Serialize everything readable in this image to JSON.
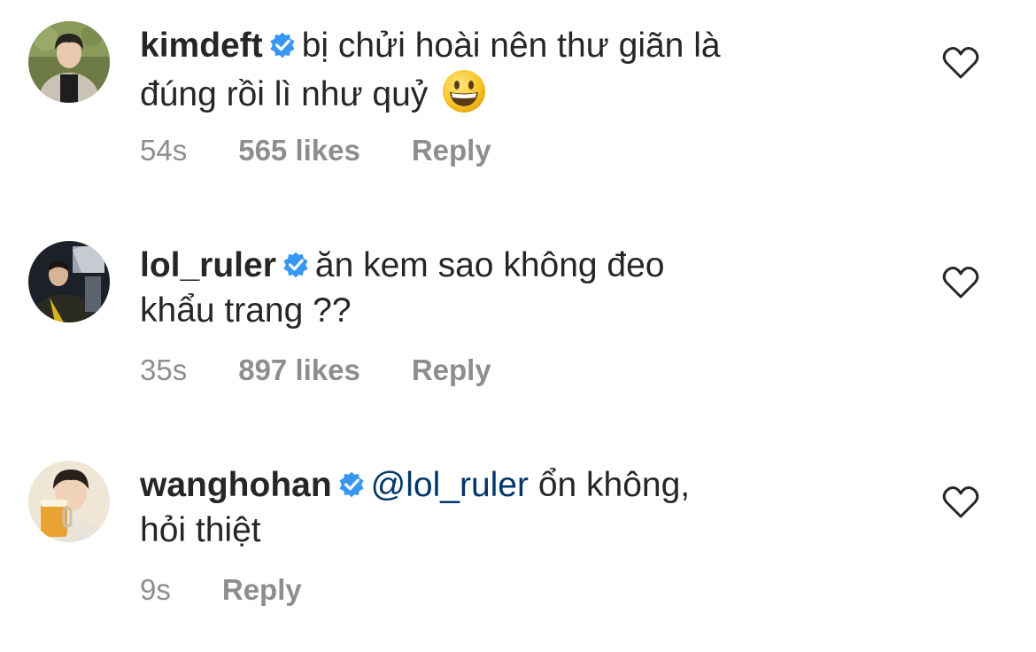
{
  "comments": [
    {
      "avatar_name": "kimdeft-avatar",
      "username": "kimdeft",
      "mention": "",
      "text": "bị chửi hoài nên thư giãn là",
      "text_line2": "đúng rồi lì như quỷ",
      "emoji": "grinning-face",
      "time": "54s",
      "likes": "565 likes",
      "reply": "Reply"
    },
    {
      "avatar_name": "lol-ruler-avatar",
      "username": "lol_ruler",
      "mention": "",
      "text": "ăn kem sao không đeo",
      "text_line2": "khẩu trang ??",
      "time": "35s",
      "likes": "897 likes",
      "reply": "Reply"
    },
    {
      "avatar_name": "wanghohan-avatar",
      "username": "wanghohan",
      "mention": "@lol_ruler",
      "text": "ổn không,",
      "text_line2": "hỏi thiệt",
      "time": "9s",
      "likes": "",
      "reply": "Reply"
    }
  ],
  "colors": {
    "verified_badge": "#3897f0",
    "mention": "#00376b",
    "meta": "#8e8e8e",
    "text": "#262626"
  },
  "icons": {
    "verified": "verified-badge-icon",
    "like": "heart-outline-icon",
    "emoji": "grinning-face-emoji"
  }
}
